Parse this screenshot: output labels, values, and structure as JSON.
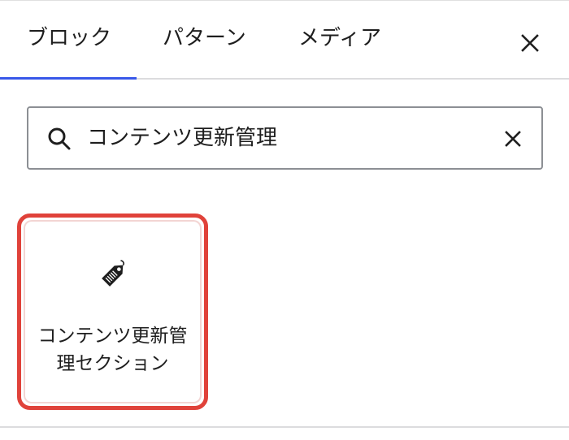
{
  "tabs": [
    {
      "label": "ブロック",
      "active": true
    },
    {
      "label": "パターン",
      "active": false
    },
    {
      "label": "メディア",
      "active": false
    }
  ],
  "close": {
    "icon": "close-icon"
  },
  "search": {
    "value": "コンテンツ更新管理",
    "icon": "search-icon",
    "clear_icon": "close-icon"
  },
  "results": [
    {
      "label": "コンテンツ更新管理セクション",
      "icon": "tag-icon"
    }
  ],
  "colors": {
    "accent": "#3858e9",
    "highlight": "#e0423a",
    "text": "#1e1e1e",
    "border": "#8c8f94"
  }
}
